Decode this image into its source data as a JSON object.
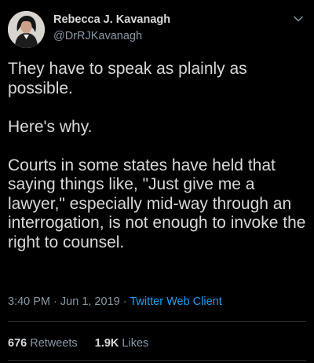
{
  "author": {
    "name": "Rebecca J. Kavanagh",
    "handle": "@DrRJKavanagh"
  },
  "tweet": {
    "paragraphs": [
      "They have to speak as plainly as possible.",
      "Here's why.",
      "Courts in some states have held that saying things like, \"Just give me a lawyer,\" especially mid-way through an interrogation, is not enough to invoke the right to counsel."
    ]
  },
  "meta": {
    "time": "3:40 PM",
    "date": "Jun 1, 2019",
    "separator": "·",
    "client": "Twitter Web Client"
  },
  "stats": {
    "retweets_count": "676",
    "retweets_label": "Retweets",
    "likes_count": "1.9K",
    "likes_label": "Likes"
  },
  "colors": {
    "background": "#000000",
    "text": "#d9d9d9",
    "secondary": "#8899a6",
    "link": "#1da1f2",
    "divider": "#2f3336"
  },
  "icons": {
    "menu": "chevron-down-icon"
  }
}
